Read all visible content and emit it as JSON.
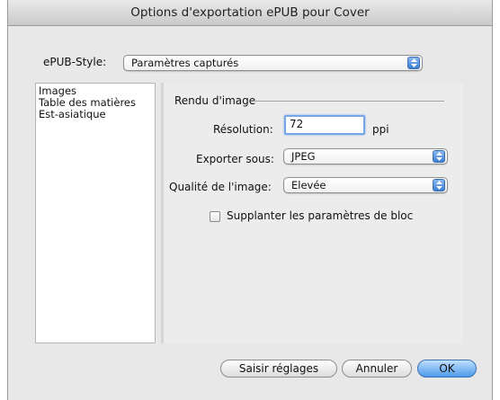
{
  "window": {
    "title": "Options d'exportation ePUB pour Cover"
  },
  "epub_style": {
    "label": "ePUB-Style:",
    "value": "Paramètres capturés"
  },
  "sidebar": {
    "items": [
      {
        "label": "Images"
      },
      {
        "label": "Table des matières"
      },
      {
        "label": "Est-asiatique"
      }
    ]
  },
  "pane": {
    "group_title": "Rendu d'image",
    "resolution": {
      "label": "Résolution:",
      "value": "72",
      "unit": "ppi"
    },
    "export_as": {
      "label": "Exporter sous:",
      "value": "JPEG"
    },
    "quality": {
      "label": "Qualité de l'image:",
      "value": "Elevée"
    },
    "override": {
      "label": "Supplanter les paramètres de bloc",
      "checked": false
    }
  },
  "buttons": {
    "capture": "Saisir réglages",
    "cancel": "Annuler",
    "ok": "OK"
  },
  "colors": {
    "accent": "#4d9ae8",
    "focus_ring": "#77a6e6"
  }
}
